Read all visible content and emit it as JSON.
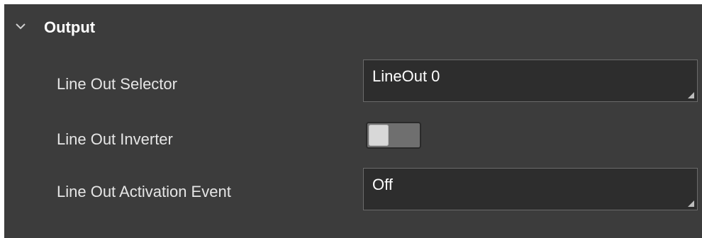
{
  "section": {
    "title": "Output",
    "expanded": true,
    "icon": "chevron-down-icon"
  },
  "rows": [
    {
      "label": "Line Out Selector",
      "value": "LineOut 0"
    },
    {
      "label": "Line Out Inverter",
      "state": "off"
    },
    {
      "label": "Line Out Activation Event",
      "value": "Off"
    }
  ],
  "colors": {
    "panel_bg": "#3c3c3c",
    "field_bg": "#2d2d2d",
    "field_border": "#6b6b6b",
    "text": "#e6e6e6"
  }
}
